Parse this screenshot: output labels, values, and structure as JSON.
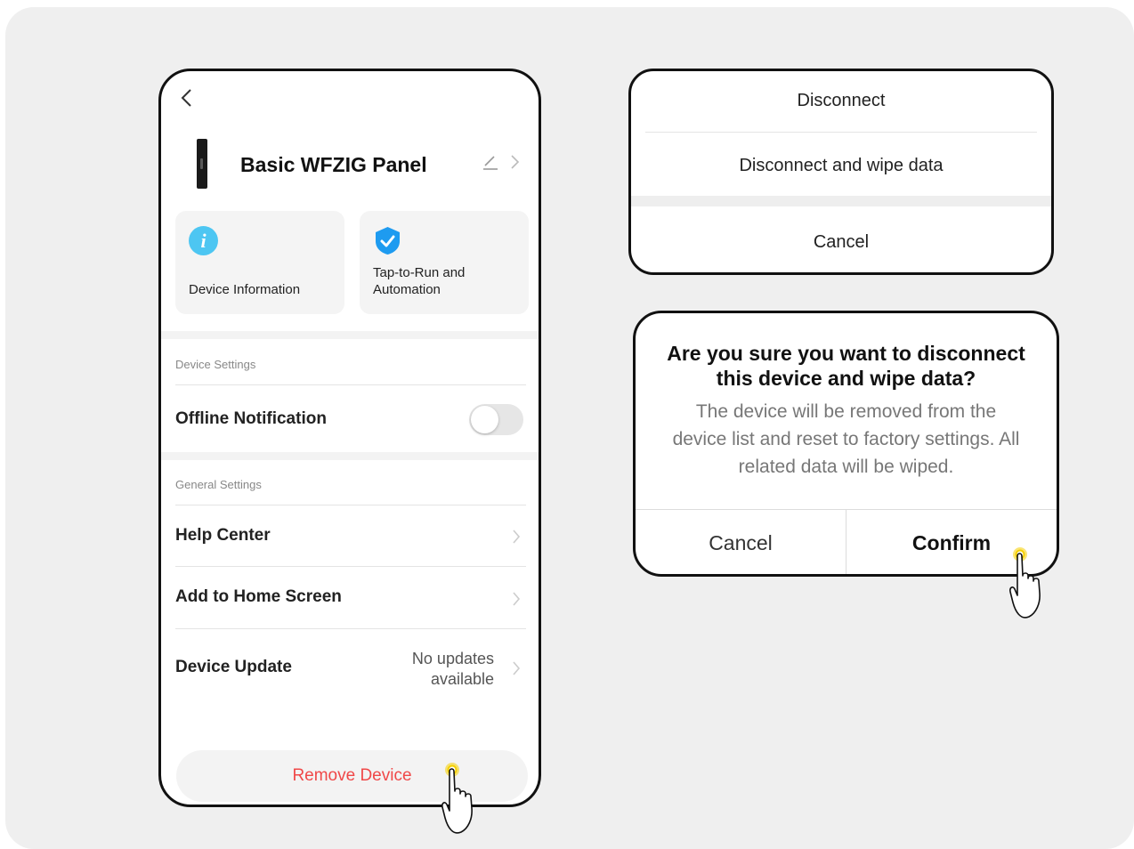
{
  "device_settings_page": {
    "device_name": "Basic WFZIG Panel",
    "cards": [
      {
        "label": "Device Information",
        "icon": "info-icon"
      },
      {
        "label": "Tap-to-Run and\nAutomation",
        "icon": "shield-check-icon"
      }
    ],
    "section_device_settings": "Device Settings",
    "offline_notification": {
      "label": "Offline Notification",
      "enabled": false
    },
    "section_general_settings": "General Settings",
    "help_center": "Help Center",
    "add_to_home_screen": "Add to Home Screen",
    "device_update": {
      "label": "Device Update",
      "status": "No updates\navailable"
    },
    "remove_device": "Remove Device"
  },
  "action_sheet": {
    "disconnect": "Disconnect",
    "disconnect_wipe": "Disconnect and wipe data",
    "cancel": "Cancel"
  },
  "confirm_dialog": {
    "title": "Are you sure you want to disconnect\nthis device and wipe data?",
    "message": "The device will be removed from the\ndevice list and reset to factory settings. All\nrelated data will be wiped.",
    "cancel": "Cancel",
    "confirm": "Confirm"
  },
  "colors": {
    "remove_text": "#f04848",
    "info_icon": "#4dc6f2",
    "shield_icon": "#1e9bf0",
    "tap_highlight": "#f5d000"
  }
}
